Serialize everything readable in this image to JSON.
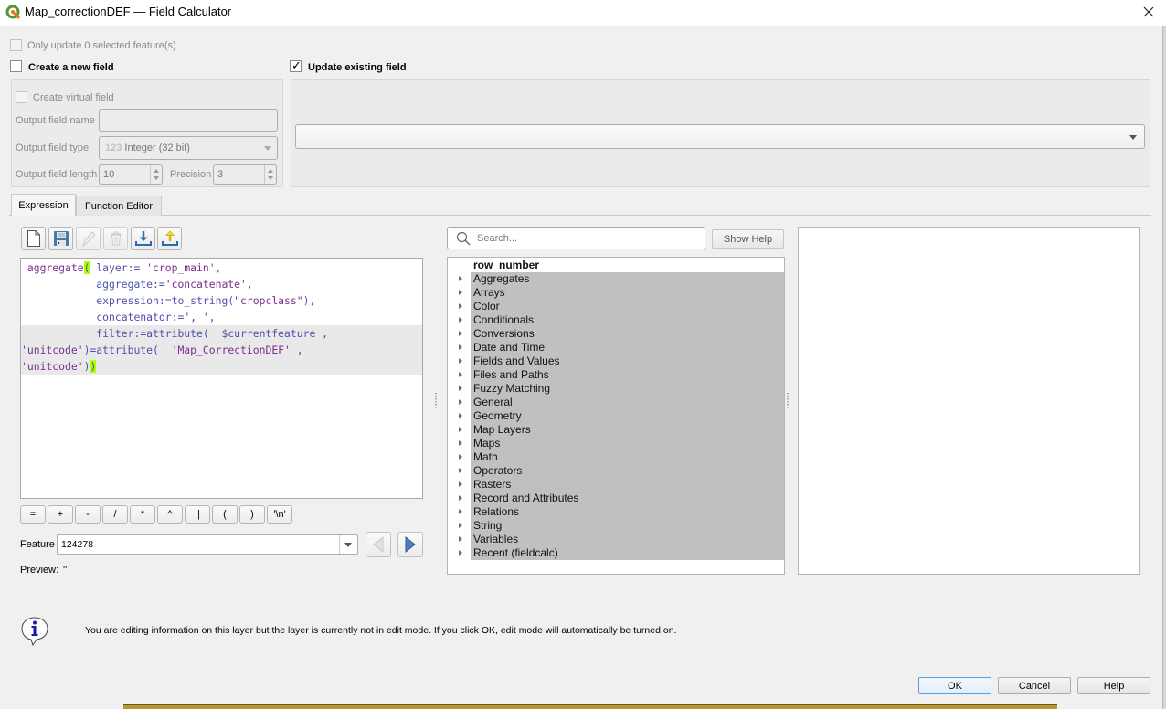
{
  "window": {
    "title": "Map_correctionDEF — Field Calculator",
    "app_icon": "qgis-logo-icon",
    "close_icon": "close-icon"
  },
  "top_options": {
    "only_selected": {
      "label": "Only update 0 selected feature(s)",
      "checked": false,
      "enabled": false
    },
    "create_new_field": {
      "label": "Create a new field",
      "checked": false
    },
    "update_existing_field": {
      "label": "Update existing field",
      "checked": true
    }
  },
  "new_field": {
    "create_virtual": {
      "label": "Create virtual field",
      "checked": false,
      "enabled": false
    },
    "output_name_label": "Output field name",
    "output_name_value": "",
    "output_type_label": "Output field type",
    "output_type_icon_text": "123",
    "output_type_value": "Integer (32 bit)",
    "output_length_label": "Output field length",
    "output_length_value": "10",
    "precision_label": "Precision",
    "precision_value": "3"
  },
  "existing_field": {
    "selected": ""
  },
  "tabs": [
    {
      "label": "Expression",
      "active": true
    },
    {
      "label": "Function Editor",
      "active": false
    }
  ],
  "toolbar": [
    {
      "name": "new-file",
      "icon": "new-document-icon",
      "enabled": true
    },
    {
      "name": "save",
      "icon": "save-icon",
      "enabled": true
    },
    {
      "name": "edit",
      "icon": "pencil-icon",
      "enabled": false
    },
    {
      "name": "delete",
      "icon": "trash-icon",
      "enabled": false
    },
    {
      "name": "import",
      "icon": "import-icon",
      "enabled": true
    },
    {
      "name": "export",
      "icon": "export-icon",
      "enabled": true
    }
  ],
  "expression": {
    "lines": [
      [
        {
          "t": " aggregate",
          "c": "fn"
        },
        {
          "t": "(",
          "c": "brace"
        },
        {
          "t": " layer:= ",
          "c": "arg"
        },
        {
          "t": "'crop_main'",
          "c": "str"
        },
        {
          "t": ",",
          "c": "arg"
        }
      ],
      [
        {
          "t": "            aggregate:=",
          "c": "arg"
        },
        {
          "t": "'concatenate'",
          "c": "str"
        },
        {
          "t": ",",
          "c": "arg"
        }
      ],
      [
        {
          "t": "            expression:=to_string(",
          "c": "arg"
        },
        {
          "t": "\"cropclass\"",
          "c": "str"
        },
        {
          "t": "),",
          "c": "arg"
        }
      ],
      [
        {
          "t": "            concatenator:=",
          "c": "arg"
        },
        {
          "t": "', '",
          "c": "str"
        },
        {
          "t": ",",
          "c": "arg"
        }
      ],
      [
        {
          "t": "            filter:=attribute(  $currentfeature ,",
          "c": "arg"
        }
      ],
      [
        {
          "t": "'unitcode'",
          "c": "str"
        },
        {
          "t": ")=attribute(  ",
          "c": "arg"
        },
        {
          "t": "'Map_CorrectionDEF'",
          "c": "str"
        },
        {
          "t": " ,",
          "c": "arg"
        }
      ],
      [
        {
          "t": "'unitcode'",
          "c": "str"
        },
        {
          "t": ")",
          "c": "arg"
        },
        {
          "t": ")",
          "c": "brace"
        }
      ]
    ]
  },
  "operators": [
    "=",
    "+",
    "-",
    "/",
    "*",
    "^",
    "||",
    "(",
    ")",
    "'\\n'"
  ],
  "feature": {
    "label": "Feature",
    "value": "124278"
  },
  "preview": {
    "label": "Preview:",
    "value": "''"
  },
  "search": {
    "placeholder": "Search...",
    "value": ""
  },
  "show_help_label": "Show Help",
  "function_tree": {
    "header": "row_number",
    "groups": [
      "Aggregates",
      "Arrays",
      "Color",
      "Conditionals",
      "Conversions",
      "Date and Time",
      "Fields and Values",
      "Files and Paths",
      "Fuzzy Matching",
      "General",
      "Geometry",
      "Map Layers",
      "Maps",
      "Math",
      "Operators",
      "Rasters",
      "Record and Attributes",
      "Relations",
      "String",
      "Variables",
      "Recent (fieldcalc)"
    ]
  },
  "info_message": "You are editing information on this layer but the layer is currently not in edit mode. If you click OK, edit mode will automatically be turned on.",
  "buttons": {
    "ok": "OK",
    "cancel": "Cancel",
    "help": "Help"
  },
  "colors": {
    "function": "#7a2e8e",
    "argument": "#4e4fb0",
    "brace_match": "#aaff00",
    "tree_group_bg": "#c0c0c0",
    "default_button_border": "#5aa0dc"
  }
}
